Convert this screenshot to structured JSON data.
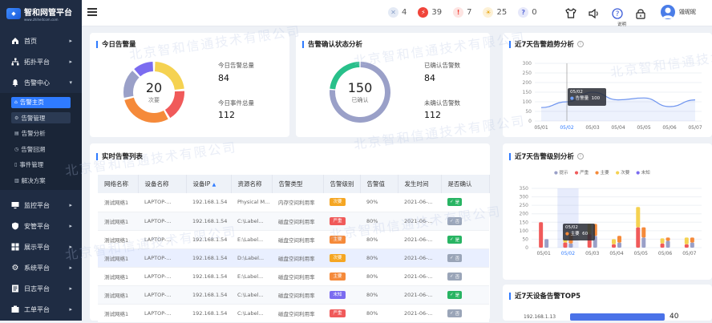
{
  "app": {
    "title": "智和网管平台",
    "subtitle": "www.zhiheitcom.com"
  },
  "sidebar": {
    "items": [
      {
        "label": "首页",
        "icon": "home-icon"
      },
      {
        "label": "拓扑平台",
        "icon": "topology-icon"
      },
      {
        "label": "告警中心",
        "icon": "bell-icon",
        "expanded": true
      }
    ],
    "subitems": [
      {
        "label": "告警主页"
      },
      {
        "label": "告警管理"
      },
      {
        "label": "告警分析"
      },
      {
        "label": "告警回溯"
      },
      {
        "label": "事件管理"
      },
      {
        "label": "解决方案"
      }
    ],
    "items_bottom": [
      {
        "label": "监控平台",
        "icon": "monitor-icon"
      },
      {
        "label": "安管平台",
        "icon": "shield-icon"
      },
      {
        "label": "展示平台",
        "icon": "grid-icon"
      },
      {
        "label": "系统平台",
        "icon": "gear-icon"
      },
      {
        "label": "日志平台",
        "icon": "log-icon"
      },
      {
        "label": "工单平台",
        "icon": "ticket-icon"
      }
    ]
  },
  "topbar": {
    "badges": [
      {
        "value": "4",
        "color": "#8aa0c8",
        "bg": "#e4eaf5",
        "icon": "x-icon",
        "symbol": "✕"
      },
      {
        "value": "39",
        "color": "#ffffff",
        "bg": "#f0443a",
        "icon": "lightning-icon",
        "symbol": "⚡"
      },
      {
        "value": "7",
        "color": "#f0443a",
        "bg": "#fde4e2",
        "icon": "exclamation-icon",
        "symbol": "!"
      },
      {
        "value": "25",
        "color": "#e8a91a",
        "bg": "#fdf1d6",
        "icon": "bulb-icon",
        "symbol": "☀"
      },
      {
        "value": "0",
        "color": "#5b6bd8",
        "bg": "#e6e8fa",
        "icon": "question-icon",
        "symbol": "?"
      }
    ],
    "tooltip": "说明",
    "user_name": "毁昵昵"
  },
  "today_alarm": {
    "title": "今日告警量",
    "donut_value": "20",
    "donut_label": "次要",
    "total_label": "今日告警总量",
    "total_value": "84",
    "event_label": "今日事件总量",
    "event_value": "112"
  },
  "confirm_status": {
    "title": "告警确认状态分析",
    "donut_value": "150",
    "donut_label": "已确认",
    "confirmed_label": "已确认告警数",
    "confirmed_value": "84",
    "unconfirmed_label": "未确认告警数",
    "unconfirmed_value": "112"
  },
  "realtime": {
    "title": "实时告警列表",
    "columns": [
      "网络名称",
      "设备名称",
      "设备IP",
      "资源名称",
      "告警类型",
      "告警级别",
      "告警值",
      "发生时间",
      "是否确认"
    ],
    "rows": [
      {
        "net": "测试网络1",
        "device": "LAPTOP-...",
        "ip": "192.168.1.54",
        "res": "Physical M...",
        "type": "内存空间利用率",
        "level": "次要",
        "lcolor": "#f5a623",
        "value": "90%",
        "time": "2021-06-...",
        "confirm": "是",
        "ccolor": "#28b463"
      },
      {
        "net": "测试网络1",
        "device": "LAPTOP-...",
        "ip": "192.168.1.54",
        "res": "C:\\Label...",
        "type": "磁盘空间利用率",
        "level": "严重",
        "lcolor": "#f05a5a",
        "value": "80%",
        "time": "2021-06-...",
        "confirm": "否",
        "ccolor": "#9aa5b8"
      },
      {
        "net": "测试网络1",
        "device": "LAPTOP-...",
        "ip": "192.168.1.54",
        "res": "E:\\Label...",
        "type": "磁盘空间利用率",
        "level": "主要",
        "lcolor": "#f58a3a",
        "value": "80%",
        "time": "2021-06-...",
        "confirm": "是",
        "ccolor": "#28b463"
      },
      {
        "net": "测试网络1",
        "device": "LAPTOP-...",
        "ip": "192.168.1.54",
        "res": "D:\\Label...",
        "type": "磁盘空间利用率",
        "level": "次要",
        "lcolor": "#f5a623",
        "value": "80%",
        "time": "2021-06-...",
        "confirm": "否",
        "ccolor": "#9aa5b8"
      },
      {
        "net": "测试网络1",
        "device": "LAPTOP-...",
        "ip": "192.168.1.54",
        "res": "E:\\Label...",
        "type": "磁盘空间利用率",
        "level": "主要",
        "lcolor": "#f58a3a",
        "value": "80%",
        "time": "2021-06-...",
        "confirm": "否",
        "ccolor": "#9aa5b8"
      },
      {
        "net": "测试网络1",
        "device": "LAPTOP-...",
        "ip": "192.168.1.54",
        "res": "C:\\Label...",
        "type": "磁盘空间利用率",
        "level": "未知",
        "lcolor": "#7b6cf0",
        "value": "80%",
        "time": "2021-06-...",
        "confirm": "是",
        "ccolor": "#28b463"
      },
      {
        "net": "测试网络1",
        "device": "LAPTOP-...",
        "ip": "192.168.1.54",
        "res": "C:\\Label...",
        "type": "磁盘空间利用率",
        "level": "严重",
        "lcolor": "#f05a5a",
        "value": "80%",
        "time": "2021-06-...",
        "confirm": "否",
        "ccolor": "#9aa5b8"
      }
    ]
  },
  "trend": {
    "title": "近7天告警趋势分析",
    "tooltip_date": "05/02",
    "tooltip_text": "告警量",
    "tooltip_value": "100"
  },
  "level_analysis": {
    "title": "近7天告警级别分析",
    "tooltip_date": "05/02",
    "tooltip_text": "主要",
    "tooltip_value": "60"
  },
  "top5": {
    "title": "近7天设备告警TOP5",
    "first_ip": "192.168.1.13",
    "first_value": "40"
  },
  "watermark": "北京智和信通技术有限公司",
  "colors": {
    "accent": "#2f7bff",
    "sidebar": "#1f2c43"
  },
  "chart_data": [
    {
      "type": "pie",
      "labels": [
        "次要",
        "严重",
        "主要",
        "提示",
        "未知"
      ],
      "values": [
        20,
        15,
        25,
        14,
        10
      ],
      "colors": [
        "#f5d251",
        "#f05a5a",
        "#f58a3a",
        "#9aa0c8",
        "#7b6cf0"
      ]
    },
    {
      "type": "pie",
      "labels": [
        "已确认",
        "未确认"
      ],
      "values": [
        150,
        46
      ],
      "colors": [
        "#9aa0c8",
        "#28c08a"
      ]
    },
    {
      "type": "line",
      "categories": [
        "05/01",
        "05/02",
        "05/03",
        "05/04",
        "05/05",
        "05/06",
        "05/07"
      ],
      "values": [
        70,
        100,
        150,
        110,
        120,
        75,
        110
      ],
      "ylim": [
        0,
        300
      ],
      "yticks": [
        "0",
        "50",
        "100",
        "150",
        "200",
        "250",
        "300"
      ]
    },
    {
      "type": "bar",
      "stacked": true,
      "categories": [
        "05/01",
        "05/02",
        "05/03",
        "05/04",
        "05/05",
        "05/06",
        "05/07"
      ],
      "legend": [
        "提示",
        "严重",
        "主要",
        "次要",
        "未知"
      ],
      "legend_colors": [
        "#9aa0c8",
        "#f05a5a",
        "#f58a3a",
        "#f5d251",
        "#7b6cf0"
      ],
      "series_left": [
        {
          "name": "严重",
          "values": [
            150,
            30,
            80,
            20,
            120,
            25,
            20
          ]
        },
        {
          "name": "次要",
          "values": [
            0,
            20,
            60,
            30,
            120,
            30,
            40
          ]
        }
      ],
      "series_right": [
        {
          "name": "提示",
          "values": [
            50,
            25,
            70,
            30,
            60,
            40,
            30
          ]
        },
        {
          "name": "主要",
          "values": [
            0,
            60,
            70,
            40,
            60,
            20,
            30
          ]
        }
      ],
      "ylim": [
        0,
        350
      ],
      "yticks": [
        "0",
        "50",
        "100",
        "150",
        "200",
        "250",
        "300",
        "350"
      ]
    }
  ]
}
